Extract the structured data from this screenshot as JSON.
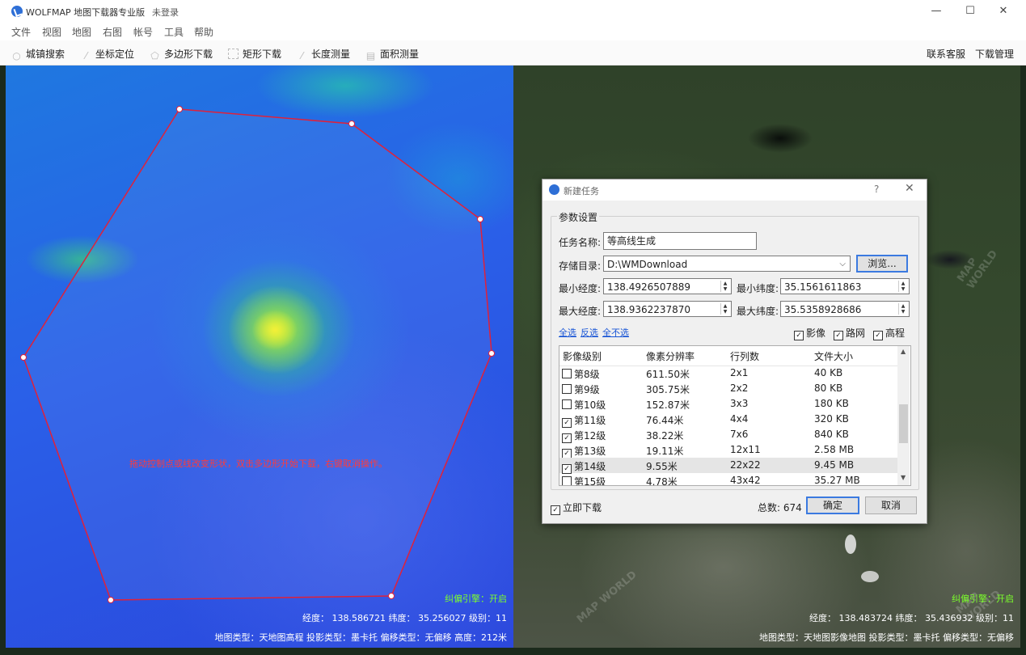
{
  "window": {
    "title": "WOLFMAP 地图下载器专业版",
    "login_status": "未登录",
    "minimize": "—",
    "maximize": "☐",
    "close": "✕"
  },
  "menu": [
    "文件",
    "视图",
    "地图",
    "右图",
    "帐号",
    "工具",
    "帮助"
  ],
  "toolbar": {
    "tools": [
      {
        "label": "城镇搜索",
        "icon": "search-icon"
      },
      {
        "label": "坐标定位",
        "icon": "pin-icon"
      },
      {
        "label": "多边形下载",
        "icon": "polygon-icon"
      },
      {
        "label": "矩形下载",
        "icon": "rectangle-icon"
      },
      {
        "label": "长度测量",
        "icon": "ruler-icon"
      },
      {
        "label": "面积测量",
        "icon": "area-icon"
      }
    ],
    "right": [
      "联系客服",
      "下载管理"
    ]
  },
  "left_map": {
    "instruction": "拖动控制点或线改变形状，双击多边形开始下载，右键取消操作。",
    "correction": "纠偏引擎：开启",
    "coords": "经度： 138.586721 纬度： 35.256027 级别：11",
    "status": "地图类型：天地图高程  投影类型：墨卡托  偏移类型：无偏移  高度：212米",
    "polygon_color": "#e0213a"
  },
  "right_map": {
    "correction": "纠偏引擎：开启",
    "coords": "经度： 138.483724 纬度： 35.436932 级别：11",
    "status": "地图类型：天地图影像地图  投影类型：墨卡托  偏移类型：无偏移",
    "watermark": "MAP WORLD"
  },
  "dialog": {
    "title": "新建任务",
    "help": "?",
    "close": "✕",
    "group": "参数设置",
    "task_name_label": "任务名称:",
    "task_name": "等高线生成",
    "dir_label": "存储目录:",
    "dir": "D:\\WMDownload",
    "browse": "浏览...",
    "min_lon_label": "最小经度:",
    "min_lon": "138.4926507889",
    "min_lat_label": "最小纬度:",
    "min_lat": "35.1561611863",
    "max_lon_label": "最大经度:",
    "max_lon": "138.9362237870",
    "max_lat_label": "最大纬度:",
    "max_lat": "35.5358928686",
    "select_all": "全选",
    "invert": "反选",
    "select_none": "全不选",
    "layers": [
      {
        "label": "影像",
        "checked": true
      },
      {
        "label": "路网",
        "checked": true
      },
      {
        "label": "高程",
        "checked": true
      }
    ],
    "table": {
      "headers": [
        "影像级别",
        "像素分辨率",
        "行列数",
        "文件大小"
      ],
      "rows": [
        {
          "level": "第8级",
          "res": "611.50米",
          "grid": "2x1",
          "size": "40 KB",
          "checked": false
        },
        {
          "level": "第9级",
          "res": "305.75米",
          "grid": "2x2",
          "size": "80 KB",
          "checked": false
        },
        {
          "level": "第10级",
          "res": "152.87米",
          "grid": "3x3",
          "size": "180 KB",
          "checked": false
        },
        {
          "level": "第11级",
          "res": "76.44米",
          "grid": "4x4",
          "size": "320 KB",
          "checked": true
        },
        {
          "level": "第12级",
          "res": "38.22米",
          "grid": "7x6",
          "size": "840 KB",
          "checked": true
        },
        {
          "level": "第13级",
          "res": "19.11米",
          "grid": "12x11",
          "size": "2.58 MB",
          "checked": true
        },
        {
          "level": "第14级",
          "res": "9.55米",
          "grid": "22x22",
          "size": "9.45 MB",
          "checked": true,
          "selected": true
        },
        {
          "level": "第15级",
          "res": "4.78米",
          "grid": "43x42",
          "size": "35.27 MB",
          "checked": false
        }
      ]
    },
    "instant_download": "立即下载",
    "total": "总数: 674",
    "ok": "确定",
    "cancel": "取消"
  }
}
